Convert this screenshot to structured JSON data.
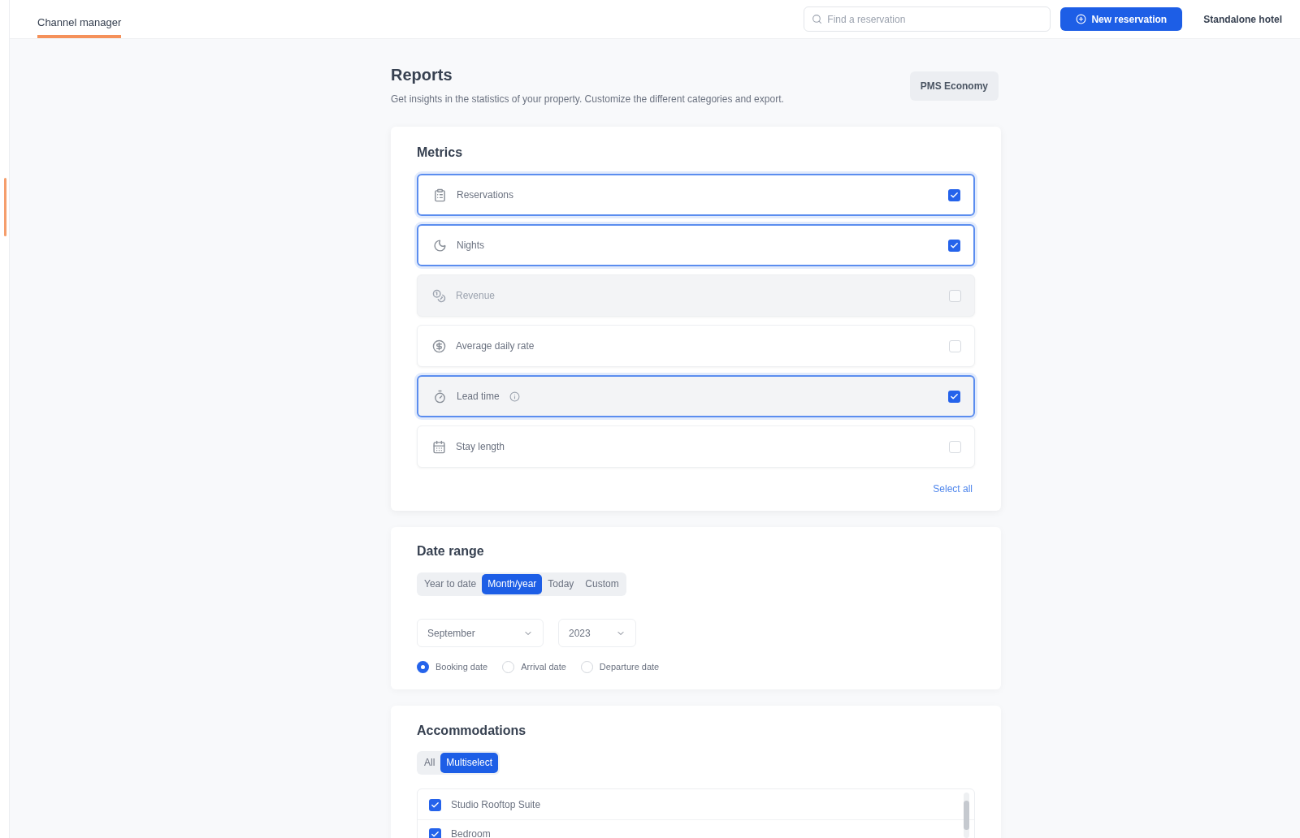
{
  "top_bar": {
    "tabs": [
      {
        "label": "Channel manager",
        "selected": true
      }
    ],
    "search": {
      "placeholder": "Find a reservation"
    },
    "new_button": {
      "label": "New reservation"
    },
    "property_name": "Standalone hotel"
  },
  "page": {
    "title": "Reports",
    "subtitle": "Get insights in the statistics of your property. Customize the different categories and export.",
    "export_button": "PMS Economy"
  },
  "metrics": {
    "title": "Metrics",
    "items": [
      {
        "label": "Reservations",
        "checked": true,
        "disabled": false,
        "hovered": false,
        "info": false
      },
      {
        "label": "Nights",
        "checked": true,
        "disabled": false,
        "hovered": false,
        "info": false
      },
      {
        "label": "Revenue",
        "checked": false,
        "disabled": true,
        "hovered": false,
        "info": false
      },
      {
        "label": "Average daily rate",
        "checked": false,
        "disabled": false,
        "hovered": false,
        "info": false
      },
      {
        "label": "Lead time",
        "checked": true,
        "disabled": false,
        "hovered": true,
        "info": true
      },
      {
        "label": "Stay length",
        "checked": false,
        "disabled": false,
        "hovered": false,
        "info": false
      }
    ],
    "select_all": "Select all"
  },
  "date_range": {
    "title": "Date range",
    "modes": [
      {
        "label": "Year to date",
        "selected": false
      },
      {
        "label": "Month/year",
        "selected": true
      },
      {
        "label": "Today",
        "selected": false
      },
      {
        "label": "Custom",
        "selected": false
      }
    ],
    "month": {
      "value": "September"
    },
    "year": {
      "value": "2023"
    },
    "date_types": [
      {
        "label": "Booking date",
        "selected": true
      },
      {
        "label": "Arrival date",
        "selected": false
      },
      {
        "label": "Departure date",
        "selected": false
      }
    ]
  },
  "accommodations": {
    "title": "Accommodations",
    "modes": [
      {
        "label": "All",
        "selected": false
      },
      {
        "label": "Multiselect",
        "selected": true
      }
    ],
    "items": [
      {
        "label": "Studio Rooftop Suite",
        "checked": true
      },
      {
        "label": "Bedroom",
        "checked": true
      }
    ]
  }
}
